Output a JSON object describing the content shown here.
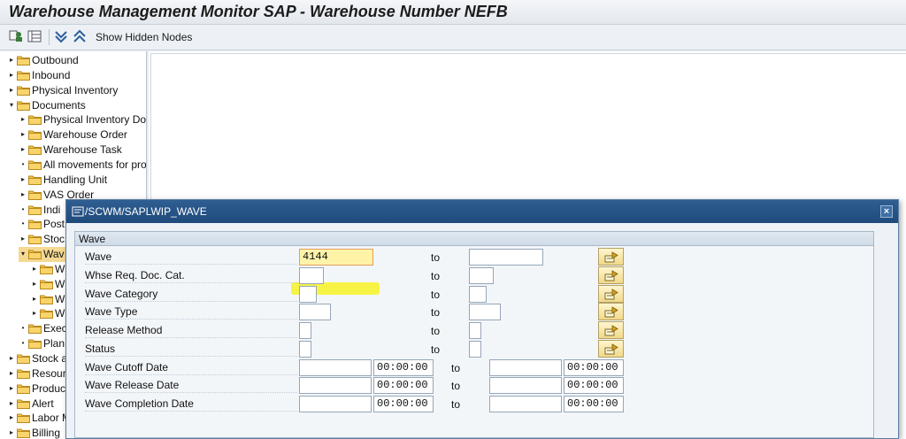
{
  "window": {
    "title": "Warehouse Management Monitor SAP - Warehouse Number NEFB"
  },
  "toolbar": {
    "show_hidden_nodes": "Show Hidden Nodes"
  },
  "tree": {
    "items": [
      {
        "label": "Outbound",
        "arrow": "▸"
      },
      {
        "label": "Inbound",
        "arrow": "▸"
      },
      {
        "label": "Physical Inventory",
        "arrow": "▸"
      },
      {
        "label": "Documents",
        "arrow": "▾"
      },
      {
        "label": "Physical Inventory Do",
        "arrow": "▸"
      },
      {
        "label": "Warehouse Order",
        "arrow": "▸"
      },
      {
        "label": "Warehouse Task",
        "arrow": "▸"
      },
      {
        "label": "All movements for pro",
        "arrow": "•"
      },
      {
        "label": "Handling Unit",
        "arrow": "▸"
      },
      {
        "label": "VAS Order",
        "arrow": "▸"
      },
      {
        "label": "Indi",
        "arrow": "•"
      },
      {
        "label": "Post",
        "arrow": "•"
      },
      {
        "label": "Stoc",
        "arrow": "▸"
      },
      {
        "label": "Wav",
        "arrow": "▾"
      },
      {
        "label": "W",
        "arrow": "▸"
      },
      {
        "label": "W",
        "arrow": "▸"
      },
      {
        "label": "W",
        "arrow": "▸"
      },
      {
        "label": "W",
        "arrow": "▸"
      },
      {
        "label": "Exec",
        "arrow": "•"
      },
      {
        "label": "Plan",
        "arrow": "•"
      },
      {
        "label": "Stock a",
        "arrow": "▸"
      },
      {
        "label": "Resour",
        "arrow": "▸"
      },
      {
        "label": "Produc",
        "arrow": "▸"
      },
      {
        "label": "Alert",
        "arrow": "▸"
      },
      {
        "label": "Labor M",
        "arrow": "▸"
      },
      {
        "label": "Billing",
        "arrow": "▸"
      }
    ]
  },
  "dialog": {
    "title": "/SCWM/SAPLWIP_WAVE",
    "close": "×",
    "group_title": "Wave",
    "to_label": "to",
    "rows": [
      {
        "label": "Wave",
        "from": "4144",
        "to": ""
      },
      {
        "label": "Whse Req. Doc. Cat.",
        "from": "",
        "to": ""
      },
      {
        "label": "Wave Category",
        "from": "",
        "to": ""
      },
      {
        "label": "Wave Type",
        "from": "",
        "to": ""
      },
      {
        "label": "Release Method",
        "from": "",
        "to": ""
      },
      {
        "label": "Status",
        "from": "",
        "to": ""
      },
      {
        "label": "Wave Cutoff Date",
        "from_date": "",
        "from_time": "00:00:00",
        "to_date": "",
        "to_time": "00:00:00"
      },
      {
        "label": "Wave Release Date",
        "from_date": "",
        "from_time": "00:00:00",
        "to_date": "",
        "to_time": "00:00:00"
      },
      {
        "label": "Wave Completion Date",
        "from_date": "",
        "from_time": "00:00:00",
        "to_date": "",
        "to_time": "00:00:00"
      }
    ]
  },
  "colors": {
    "titlebar_blue": "#1f4a7b",
    "highlight": "#f7f226",
    "selected_node": "#f5d993"
  }
}
